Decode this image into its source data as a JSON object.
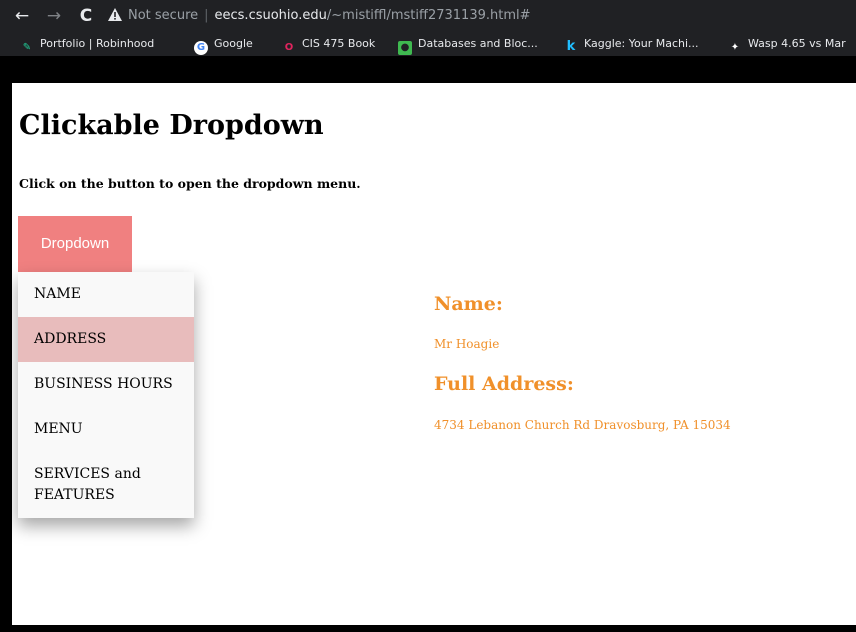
{
  "browser": {
    "back_icon": "←",
    "forward_icon": "→",
    "reload_icon": "C",
    "security_label": "Not secure",
    "url_domain": "eecs.csuohio.edu",
    "url_path": "/~mistiffl/mstiff2731139.html#",
    "bookmarks": [
      {
        "label": "Portfolio | Robinhood",
        "icon": "robinhood-feather-icon",
        "color": "#21ce99"
      },
      {
        "label": "Google",
        "icon": "google-icon",
        "color": "#4285f4"
      },
      {
        "label": "CIS 475 Book",
        "icon": "opera-like-icon",
        "color": "#e0245e"
      },
      {
        "label": "Databases and Bloc...",
        "icon": "green-square-icon",
        "color": "#3fb950"
      },
      {
        "label": "Kaggle: Your Machi...",
        "icon": "kaggle-k-icon",
        "color": "#20beff"
      },
      {
        "label": "Wasp 4.65 vs Mar",
        "icon": "wasp-icon",
        "color": "#ffffff"
      }
    ]
  },
  "page": {
    "title": "Clickable Dropdown",
    "subtitle": "Click on the button to open the dropdown menu.",
    "dropdown_button": "Dropdown",
    "menu": [
      "NAME",
      "ADDRESS",
      "BUSINESS HOURS",
      "MENU",
      "SERVICES and FEATURES"
    ],
    "active_index": 1,
    "info": {
      "name_heading": "Name:",
      "name_value": "Mr Hoagie",
      "address_heading": "Full Address:",
      "address_value": "4734 Lebanon Church Rd Dravosburg, PA 15034"
    }
  },
  "colors": {
    "button_bg": "#f08080",
    "menu_hover": "#e8bcbc",
    "info_text": "#f0902a"
  }
}
